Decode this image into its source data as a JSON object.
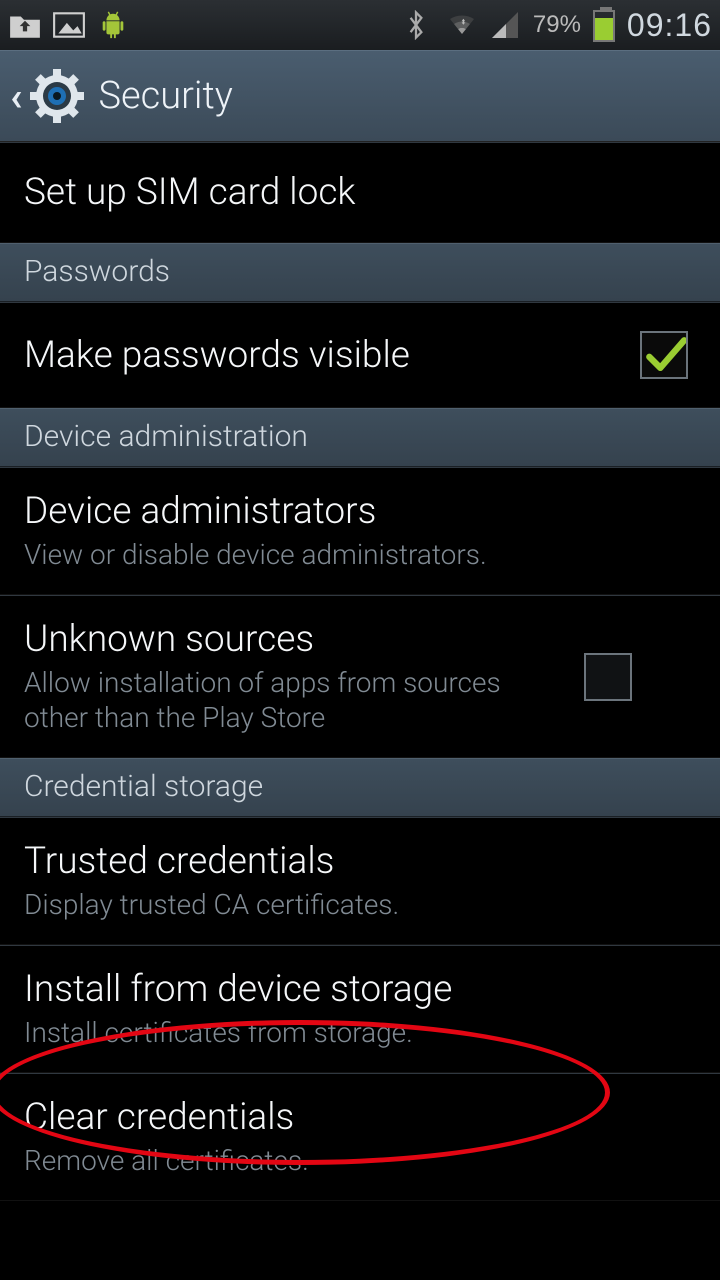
{
  "status_bar": {
    "battery_pct": "79%",
    "clock": "09:16"
  },
  "action_bar": {
    "title": "Security"
  },
  "items": {
    "sim_lock": {
      "title": "Set up SIM card lock"
    },
    "cat_passwords": {
      "title": "Passwords"
    },
    "passwords_visible": {
      "title": "Make passwords visible"
    },
    "cat_device_admin": {
      "title": "Device administration"
    },
    "device_admins": {
      "title": "Device administrators",
      "sub": "View or disable device administrators."
    },
    "unknown_sources": {
      "title": "Unknown sources",
      "sub": "Allow installation of apps from sources other than the Play Store"
    },
    "cat_cred_storage": {
      "title": "Credential storage"
    },
    "trusted_creds": {
      "title": "Trusted credentials",
      "sub": "Display trusted CA certificates."
    },
    "install_storage": {
      "title": "Install from device storage",
      "sub": "Install certificates from storage."
    },
    "clear_creds": {
      "title": "Clear credentials",
      "sub": "Remove all certificates."
    }
  }
}
